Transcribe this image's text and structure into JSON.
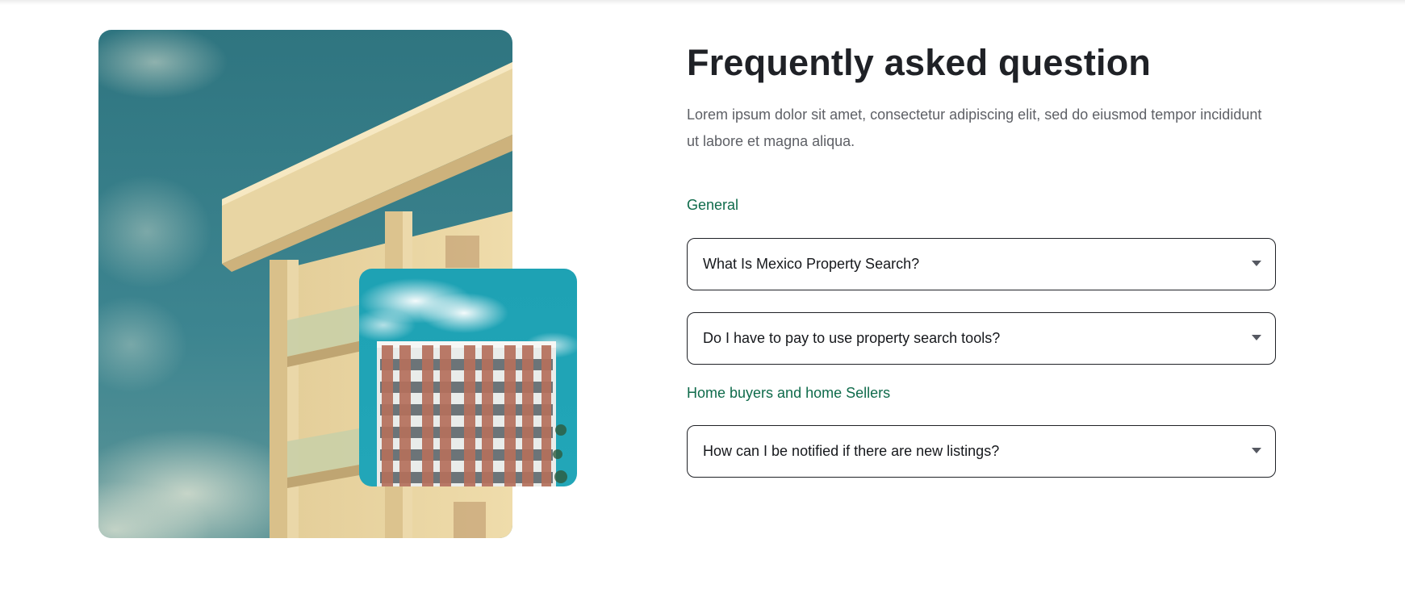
{
  "faq": {
    "title": "Frequently asked question",
    "intro": "Lorem ipsum dolor sit amet, consectetur adipiscing elit, sed do eiusmod tempor incididunt ut labore et magna aliqua.",
    "categories": [
      {
        "label": "General",
        "items": [
          {
            "question": "What Is Mexico Property Search?",
            "icon": "caret-down-icon"
          },
          {
            "question": "Do I have to pay to use property search tools?",
            "icon": "caret-down-icon"
          }
        ]
      },
      {
        "label": "Home buyers and home Sellers",
        "items": [
          {
            "question": "How can I be notified if there are new listings?",
            "icon": "caret-down-icon"
          }
        ]
      }
    ]
  },
  "images": {
    "large": "building-corner-photo",
    "small": "apartment-building-photo"
  },
  "colors": {
    "heading": "#1f2126",
    "body_text": "#5e6066",
    "category": "#0f6b4b",
    "border": "#1f2126",
    "sky": "#2b7a84",
    "facade": "#e7d3a1"
  }
}
